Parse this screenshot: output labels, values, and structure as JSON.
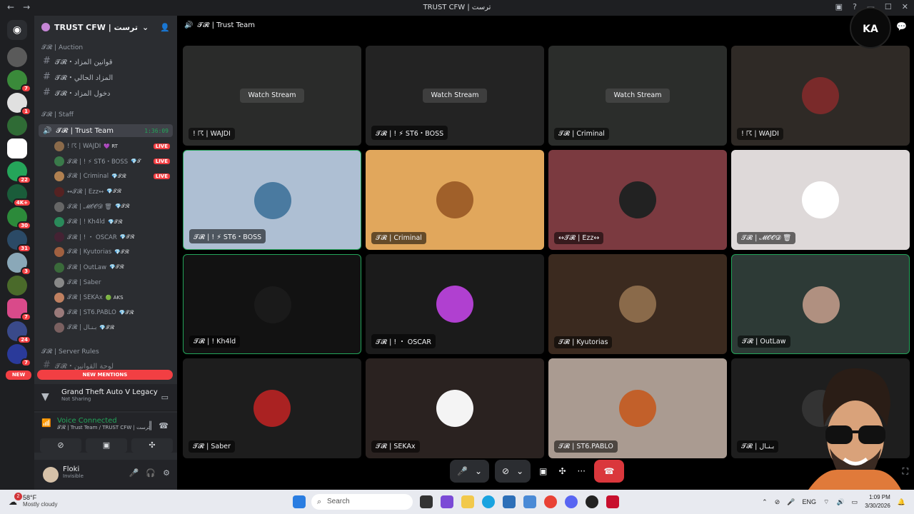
{
  "window": {
    "title": "TRUST CFW | ترست"
  },
  "server": {
    "name": "TRUST CFW | ترست"
  },
  "categories": {
    "auction": "𝓣𝓡 | Auction",
    "staff": "𝓣𝓡 | Staff",
    "rules": "𝓣𝓡 | Server Rules"
  },
  "channels": {
    "c1": "𝓣𝓡・قوانين المزاد",
    "c2": "𝓣𝓡・المزاد الحالي",
    "c3": "𝓣𝓡・دخول المزاد",
    "c4": "𝓣𝓡・لوحة القوانين"
  },
  "voice_channel": {
    "name": "𝓣𝓡 | Trust Team",
    "timer": "1:36:09"
  },
  "voice_users": [
    {
      "name": "! ☈ | WAJDI",
      "tag": "💜 RT",
      "live": "LIVE"
    },
    {
      "name": "𝓣𝓡 | ! ⚡ ST6・BOSS",
      "tag": "💎𝓣",
      "live": "LIVE"
    },
    {
      "name": "𝓣𝓡 | Criminal",
      "tag": "💎𝓣𝓡",
      "live": "LIVE"
    },
    {
      "name": "↔𝓣𝓡 | Ezz↔",
      "tag": "💎𝓣𝓡",
      "live": ""
    },
    {
      "name": "𝓣𝓡 | 𝓜𝓞𝓞𝓓 🗑",
      "tag": "💎𝓣𝓡",
      "live": ""
    },
    {
      "name": "𝓣𝓡 | ! Kh4ld",
      "tag": "💎𝓣𝓡",
      "live": ""
    },
    {
      "name": "𝓣𝓡 | ! ・ OSCAR",
      "tag": "💎𝓣𝓡",
      "live": ""
    },
    {
      "name": "𝓣𝓡 | Kyutorias",
      "tag": "💎𝓣𝓡",
      "live": ""
    },
    {
      "name": "𝓣𝓡 | OutLaw",
      "tag": "💎𝓣𝓡",
      "live": ""
    },
    {
      "name": "𝓣𝓡 | Saber",
      "tag": "",
      "live": ""
    },
    {
      "name": "𝓣𝓡 | SEKAx",
      "tag": "🟢 AKS",
      "live": ""
    },
    {
      "name": "𝓣𝓡 | ST6.PABLO",
      "tag": "💎𝓣𝓡",
      "live": ""
    },
    {
      "name": "𝓣𝓡 | بـنـال",
      "tag": "💎𝓣𝓡",
      "live": ""
    }
  ],
  "new_mentions": "NEW MENTIONS",
  "new_tag": "NEW",
  "activity": {
    "game": "Grand Theft Auto V Legacy",
    "status": "Not Sharing"
  },
  "voice_connection": {
    "status": "Voice Connected",
    "location": "𝓣𝓡 | Trust Team / TRUST CFW | ترست"
  },
  "user": {
    "name": "Floki",
    "status": "Invisible"
  },
  "stage_header": "𝓣𝓡 | Trust Team",
  "tiles": [
    {
      "label": "! ☈ | WAJDI",
      "watch": "Watch Stream",
      "bg": "#2a2b2a"
    },
    {
      "label": "𝓣𝓡 | ! ⚡ ST6・BOSS",
      "watch": "Watch Stream",
      "bg": "#232323"
    },
    {
      "label": "𝓣𝓡 | Criminal",
      "watch": "Watch Stream",
      "bg": "#2b2d2b"
    },
    {
      "label": "! ☈ | WAJDI",
      "watch": "",
      "bg": "#2f2a26"
    },
    {
      "label": "𝓣𝓡 | ! ⚡ ST6・BOSS",
      "watch": "",
      "bg": "#aebfd3"
    },
    {
      "label": "𝓣𝓡 | Criminal",
      "watch": "",
      "bg": "#e1a75c"
    },
    {
      "label": "↔𝓣𝓡 | Ezz↔",
      "watch": "",
      "bg": "#7b3a40"
    },
    {
      "label": "𝓣𝓡 | 𝓜𝓞𝓞𝓓 🗑",
      "watch": "",
      "bg": "#ded9d9"
    },
    {
      "label": "𝓣𝓡 | ! Kh4ld",
      "watch": "",
      "bg": "#121212"
    },
    {
      "label": "𝓣𝓡 | ! ・ OSCAR",
      "watch": "",
      "bg": "#1b1b1b"
    },
    {
      "label": "𝓣𝓡 | Kyutorias",
      "watch": "",
      "bg": "#3b2a1f"
    },
    {
      "label": "𝓣𝓡 | OutLaw",
      "watch": "",
      "bg": "#2d3a36"
    },
    {
      "label": "𝓣𝓡 | Saber",
      "watch": "",
      "bg": "#1d1d1d"
    },
    {
      "label": "𝓣𝓡 | SEKAx",
      "watch": "",
      "bg": "#2a2220"
    },
    {
      "label": "𝓣𝓡 | ST6.PABLO",
      "watch": "",
      "bg": "#aa9b91"
    },
    {
      "label": "𝓣𝓡 | بـنـال",
      "watch": "",
      "bg": "#1e1e1e"
    }
  ],
  "taskbar": {
    "temp": "58°F",
    "weather": "Mostly cloudy",
    "weather_badge": "2",
    "search_placeholder": "Search",
    "lang": "ENG",
    "time": "1:09 PM",
    "date": "3/30/2026"
  },
  "overlay_logo": "KA",
  "colors": {
    "live": "#f23f43",
    "speaking": "#23a55a",
    "end_call": "#da373c"
  }
}
